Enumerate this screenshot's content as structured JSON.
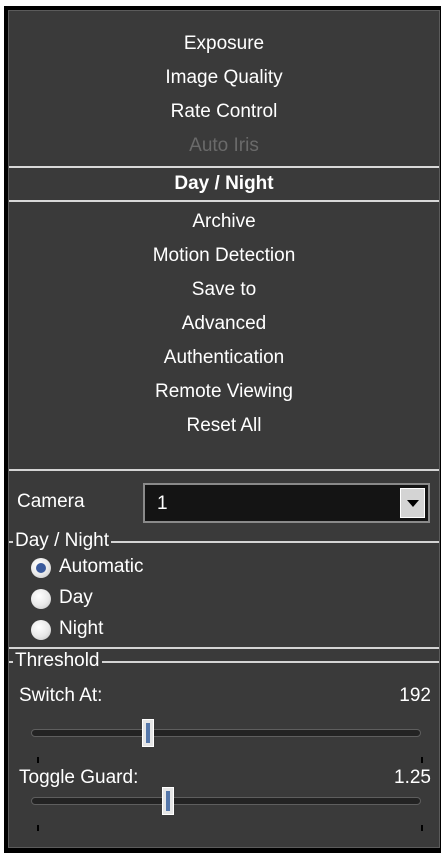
{
  "menu": {
    "items": [
      {
        "label": "Exposure",
        "state": "normal"
      },
      {
        "label": "Image Quality",
        "state": "normal"
      },
      {
        "label": "Rate Control",
        "state": "normal"
      },
      {
        "label": "Auto Iris",
        "state": "disabled"
      },
      {
        "label": "Day / Night",
        "state": "selected"
      },
      {
        "label": "Archive",
        "state": "normal"
      },
      {
        "label": "Motion Detection",
        "state": "normal"
      },
      {
        "label": "Save to",
        "state": "normal"
      },
      {
        "label": "Advanced",
        "state": "normal"
      },
      {
        "label": "Authentication",
        "state": "normal"
      },
      {
        "label": "Remote Viewing",
        "state": "normal"
      },
      {
        "label": "Reset All",
        "state": "normal"
      }
    ]
  },
  "camera": {
    "label": "Camera",
    "value": "1",
    "dropdown_icon": "chevron-down-icon"
  },
  "day_night": {
    "title": "Day / Night",
    "options": [
      {
        "label": "Automatic",
        "checked": true
      },
      {
        "label": "Day",
        "checked": false
      },
      {
        "label": "Night",
        "checked": false
      }
    ]
  },
  "threshold": {
    "title": "Threshold",
    "switch_at": {
      "label": "Switch At:",
      "value": "192",
      "level": 0.3
    },
    "toggle_guard": {
      "label": "Toggle Guard:",
      "value": "1.25",
      "level": 0.35
    }
  },
  "colors": {
    "background": "#3a3a3a",
    "accent": "#3a5a9c",
    "text": "#ffffff",
    "disabled_text": "#6a6a6a"
  }
}
